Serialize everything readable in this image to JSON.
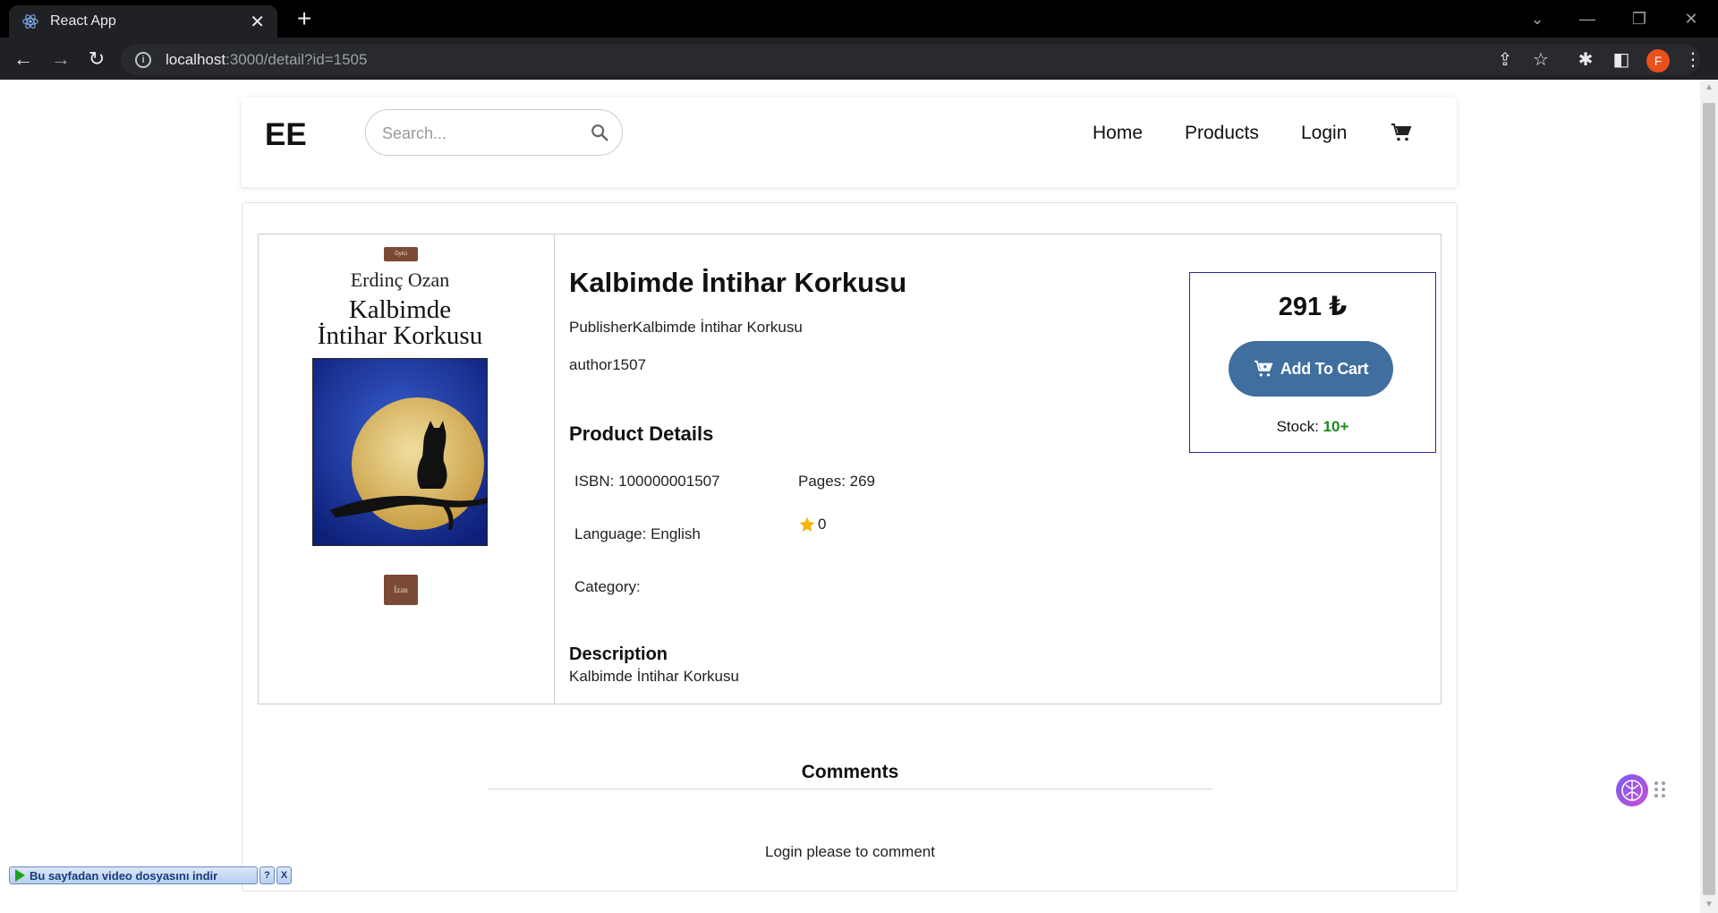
{
  "browser": {
    "tab_title": "React App",
    "url_host": "localhost",
    "url_rest": ":3000/detail?id=1505"
  },
  "profile": {
    "initial": "F",
    "color": "#e8501c"
  },
  "header": {
    "logo": "EE",
    "search_placeholder": "Search...",
    "nav": [
      "Home",
      "Products",
      "Login"
    ]
  },
  "product": {
    "title": "Kalbimde İntihar Korkusu",
    "publisher": "PublisherKalbimde İntihar Korkusu",
    "author": "author1507",
    "details_heading": "Product Details",
    "isbn": "ISBN: 100000001507",
    "pages": "Pages: 269",
    "language": "Language: English",
    "rating": "0",
    "category": "Category:",
    "description_heading": "Description",
    "description": "Kalbimde İntihar Korkusu",
    "cover": {
      "author": "Erdinç Ozan",
      "title_line1": "Kalbimde",
      "title_line2": "İntihar Korkusu",
      "seal": "Öykü",
      "publisher_mark": "İzan"
    }
  },
  "purchase": {
    "price": "291 ₺",
    "add_to_cart": "Add To Cart",
    "stock_label": "Stock:",
    "stock_value": "10+",
    "accent": "#3f6e9f",
    "stock_color": "#1c8a1c"
  },
  "comments": {
    "title": "Comments",
    "login_prompt": "Login please to comment"
  },
  "extension_bar": {
    "label": "Bu sayfadan video dosyasını indir",
    "help": "?",
    "close": "X"
  }
}
